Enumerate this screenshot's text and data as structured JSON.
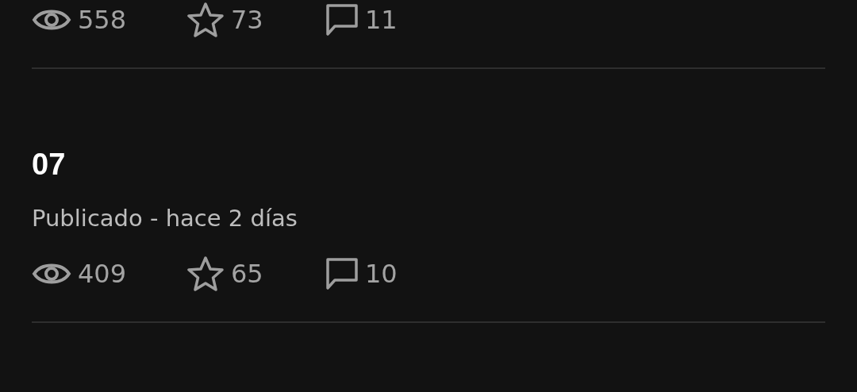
{
  "chapters": [
    {
      "views": "558",
      "stars": "73",
      "comments": "11"
    },
    {
      "title": "07",
      "status": "Publicado - hace 2 días",
      "views": "409",
      "stars": "65",
      "comments": "10"
    }
  ]
}
